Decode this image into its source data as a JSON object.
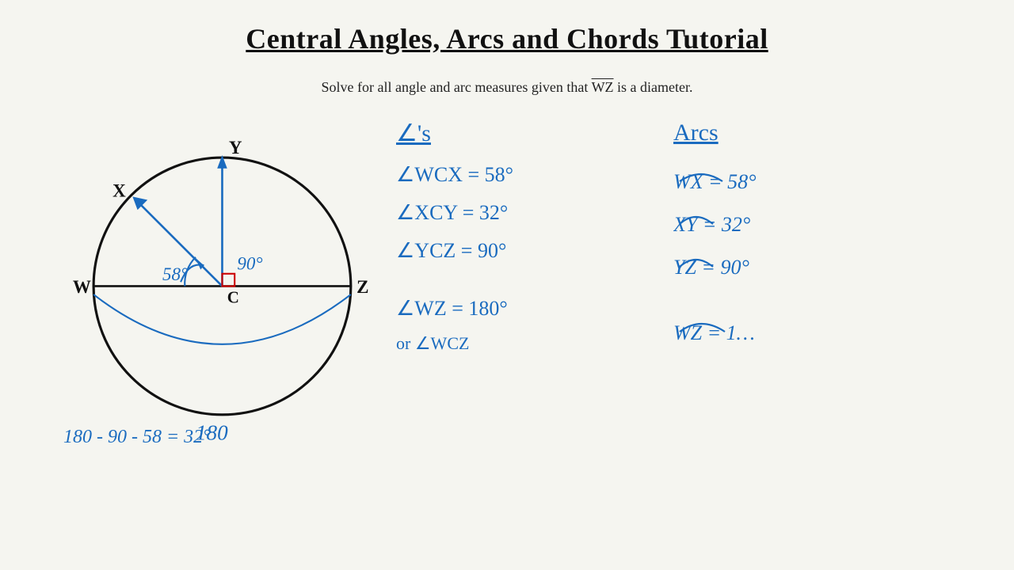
{
  "title": "Central Angles, Arcs and Chords Tutorial",
  "subtitle": {
    "text": "Solve for all angle and arc measures given that",
    "diameter_label": "WZ",
    "suffix": "is a diameter."
  },
  "circle": {
    "center_label": "C",
    "points": [
      "W",
      "X",
      "Y",
      "Z"
    ],
    "angle_58": "58°",
    "angle_90": "90°",
    "arc_180": "180"
  },
  "angles_header": "∠'s",
  "angles": [
    "∠WCX = 58°",
    "∠XCY = 32°",
    "∠YCZ = 90°",
    "∠WZ  = 180°",
    "or ∠WCZ"
  ],
  "arcs_header": "Arcs",
  "arcs": [
    "WX = 58°",
    "XY = 32°",
    "YZ = 90°",
    "WZ = 1…"
  ],
  "calculation": "180 - 90 - 58 = 32°"
}
